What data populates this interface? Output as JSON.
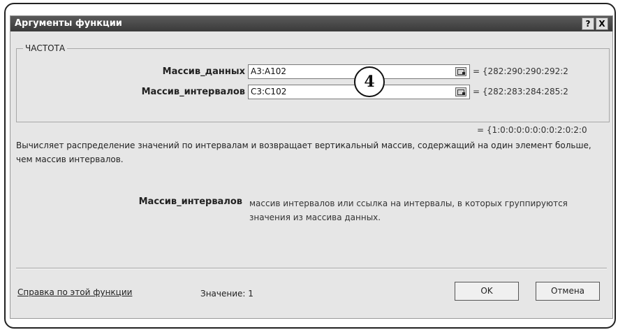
{
  "dialog": {
    "title": "Аргументы функции",
    "help_button": "?",
    "close_button": "X"
  },
  "function_group": {
    "name": "ЧАСТОТА",
    "args": [
      {
        "label": "Массив_данных",
        "value": "A3:A102",
        "preview": "= {282:290:290:292:2"
      },
      {
        "label": "Массив_интервалов",
        "value": "C3:C102",
        "preview": "= {282:283:284:285:2"
      }
    ]
  },
  "result_preview": "= {1:0:0:0:0:0:0:0:2:0:2:0",
  "description": "Вычисляет распределение значений по интервалам и возвращает вертикальный массив, содержащий на один элемент больше, чем массив интервалов.",
  "param_help": {
    "name": "Массив_интервалов",
    "text": "массив интервалов или ссылка на интервалы, в которых группируются значения из массива данных."
  },
  "footer": {
    "help_link": "Справка по этой функции",
    "value_label": "Значение: 1",
    "ok_label": "OK",
    "cancel_label": "Отмена"
  },
  "callout_number": "4"
}
